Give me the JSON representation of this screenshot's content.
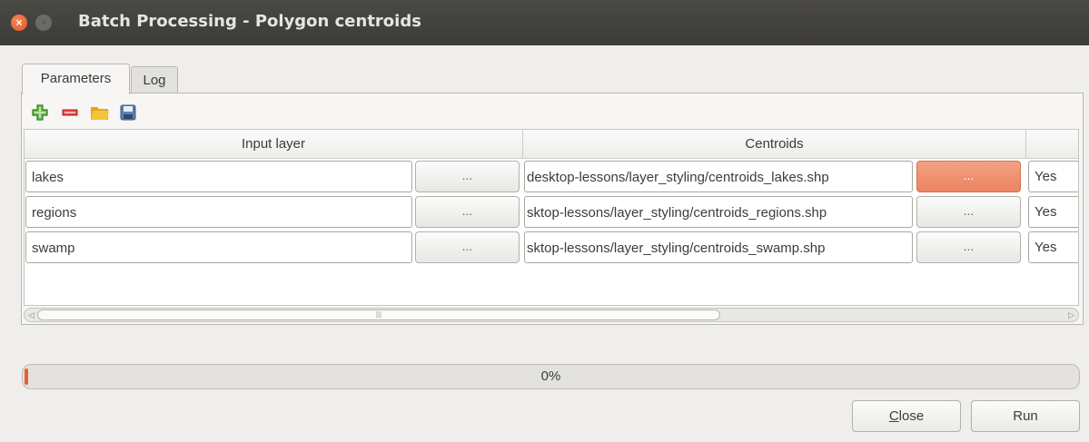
{
  "window": {
    "title": "Batch Processing - Polygon centroids",
    "close_glyph": "×",
    "minimize_glyph": "▫"
  },
  "tabs": [
    {
      "label": "Parameters",
      "active": true
    },
    {
      "label": "Log",
      "active": false
    }
  ],
  "toolbar": {
    "add_row": {
      "icon": "plus-icon",
      "color": "#3a9a2e"
    },
    "remove_row": {
      "icon": "minus-icon",
      "color": "#d9302a"
    },
    "open": {
      "icon": "folder-icon",
      "color": "#f2b21d"
    },
    "save": {
      "icon": "save-icon",
      "color": "#4a6fa5"
    }
  },
  "table": {
    "headers": [
      "Input layer",
      "Centroids"
    ],
    "browse_label": "...",
    "rows": [
      {
        "input": "lakes",
        "output": "desktop-lessons/layer_styling/centroids_lakes.shp",
        "load": "Yes"
      },
      {
        "input": "regions",
        "output": "sktop-lessons/layer_styling/centroids_regions.shp",
        "load": "Yes"
      },
      {
        "input": "swamp",
        "output": "sktop-lessons/layer_styling/centroids_swamp.shp",
        "load": "Yes"
      }
    ]
  },
  "scrollbar": {
    "left_arrow": "◁",
    "right_arrow": "▷",
    "grip": "|||"
  },
  "progress": {
    "value": 0,
    "label": "0%"
  },
  "buttons": {
    "close_label_first": "C",
    "close_label_rest": "lose",
    "run_label": "Run"
  },
  "colors": {
    "accent": "#e9602e",
    "highlight_button": "#eb8360",
    "titlebar": "#3c3b37"
  }
}
